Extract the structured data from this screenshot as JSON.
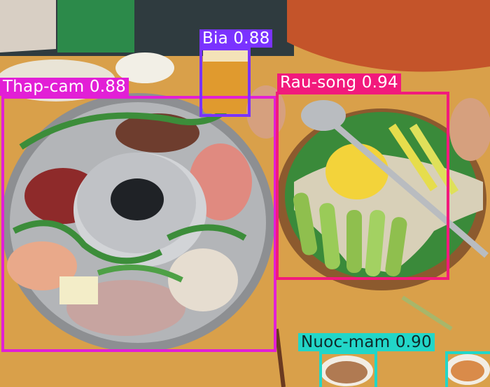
{
  "image": {
    "description_colors": {
      "table": "#d9a04a",
      "person_shirt": "#c4542a",
      "pot": "#a7a9ab"
    }
  },
  "detections": [
    {
      "label": "Thap-cam",
      "score": "0.88",
      "color": "#e21fd6"
    },
    {
      "label": "Bia",
      "score": "0.88",
      "color": "#7a33ff"
    },
    {
      "label": "Rau-song",
      "score": "0.94",
      "color": "#f21a7c"
    },
    {
      "label": "Nuoc-mam",
      "score": "0.90",
      "color": "#22d6c8"
    },
    {
      "label": "Nuoc-mam",
      "score": "0.90",
      "color": "#22d6c8"
    }
  ]
}
